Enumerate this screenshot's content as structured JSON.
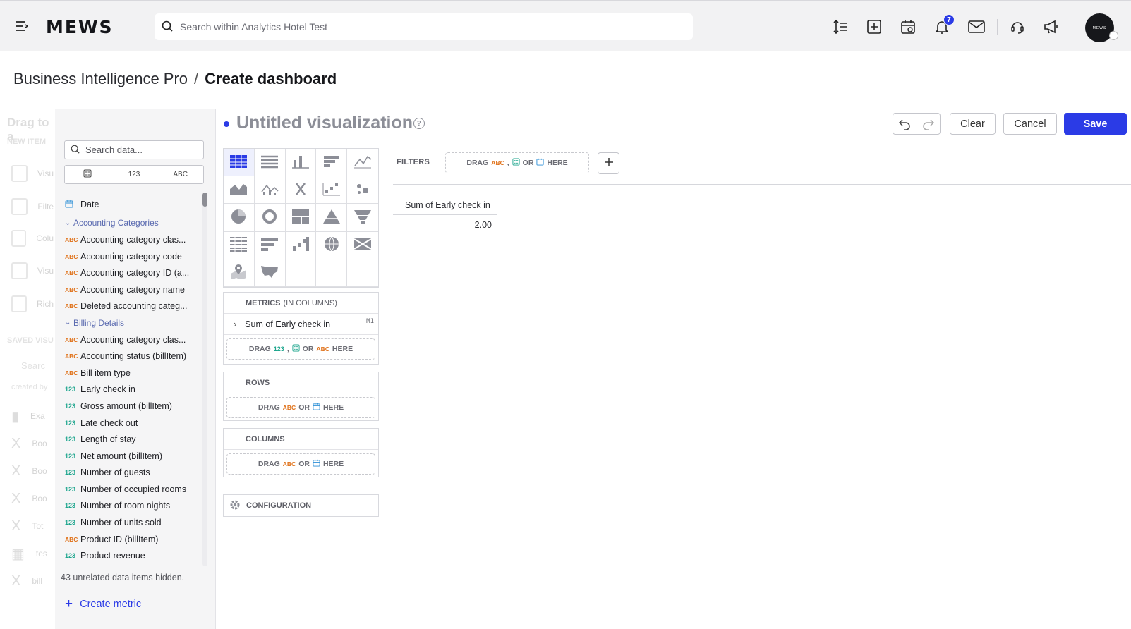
{
  "header": {
    "logo": "MEWS",
    "search_placeholder": "Search within Analytics Hotel Test",
    "notifications_count": "7",
    "avatar_text": "MEWS"
  },
  "breadcrumb": {
    "parent": "Business Intelligence Pro",
    "separator": "/",
    "current": "Create dashboard"
  },
  "background_panel": {
    "title": "Drag to a",
    "new_item": "NEW ITEM",
    "items": [
      "Visu",
      "Filte",
      "Colu",
      "Visu",
      "Rich"
    ],
    "saved": "SAVED VISU",
    "search": "Searc",
    "created_by": "created by",
    "saved_items": [
      {
        "name": "Exa",
        "sub": "TOD"
      },
      {
        "name": "Boo",
        "sub": "JAN"
      },
      {
        "name": "Boo",
        "sub": "JAN"
      },
      {
        "name": "Boo",
        "sub": "JAN"
      },
      {
        "name": "Tot",
        "sub": "JAN"
      },
      {
        "name": "tes",
        "sub": "DEC"
      },
      {
        "name": "bill",
        "sub": "SEP"
      }
    ]
  },
  "data_panel": {
    "search_placeholder": "Search data...",
    "filter_tabs": [
      "",
      "123",
      "ABC"
    ],
    "items": [
      {
        "kind": "date",
        "label": "Date"
      },
      {
        "kind": "group",
        "label": "Accounting Categories"
      },
      {
        "kind": "abc",
        "label": "Accounting category clas..."
      },
      {
        "kind": "abc",
        "label": "Accounting category code"
      },
      {
        "kind": "abc",
        "label": "Accounting category ID (a..."
      },
      {
        "kind": "abc",
        "label": "Accounting category name"
      },
      {
        "kind": "abc",
        "label": "Deleted accounting categ..."
      },
      {
        "kind": "group",
        "label": "Billing Details"
      },
      {
        "kind": "abc",
        "label": "Accounting category clas..."
      },
      {
        "kind": "abc",
        "label": "Accounting status (billItem)"
      },
      {
        "kind": "abc",
        "label": "Bill item type"
      },
      {
        "kind": "num",
        "label": "Early check in"
      },
      {
        "kind": "num",
        "label": "Gross amount (billItem)"
      },
      {
        "kind": "num",
        "label": "Late check out"
      },
      {
        "kind": "num",
        "label": "Length of stay"
      },
      {
        "kind": "num",
        "label": "Net amount (billItem)"
      },
      {
        "kind": "num",
        "label": "Number of guests"
      },
      {
        "kind": "num",
        "label": "Number of occupied rooms"
      },
      {
        "kind": "num",
        "label": "Number of room nights"
      },
      {
        "kind": "num",
        "label": "Number of units sold"
      },
      {
        "kind": "abc",
        "label": "Product ID (billItem)"
      },
      {
        "kind": "num",
        "label": "Product revenue"
      }
    ],
    "type_tags": {
      "abc": "ABC",
      "num": "123"
    },
    "hidden_note": "43 unrelated data items hidden.",
    "create_metric": "Create metric"
  },
  "visualization": {
    "title": "Untitled visualization",
    "help": "?",
    "buttons": {
      "clear": "Clear",
      "cancel": "Cancel",
      "save": "Save"
    }
  },
  "buckets": {
    "metrics": {
      "title": "METRICS",
      "subtitle": "(IN COLUMNS)",
      "item": "Sum of Early check in",
      "item_tag": "M1"
    },
    "rows": {
      "title": "ROWS"
    },
    "columns": {
      "title": "COLUMNS"
    },
    "configuration": "CONFIGURATION",
    "drop": {
      "drag": "DRAG",
      "or": "OR",
      "here": "HERE",
      "abc": "ABC",
      "num": "123",
      "comma": ","
    }
  },
  "filters": {
    "label": "FILTERS"
  },
  "preview": {
    "header": "Sum of Early check in",
    "value": "2.00"
  },
  "colors": {
    "accent": "#2b3be6",
    "abc": "#e0731c",
    "num": "#1fa68e"
  }
}
